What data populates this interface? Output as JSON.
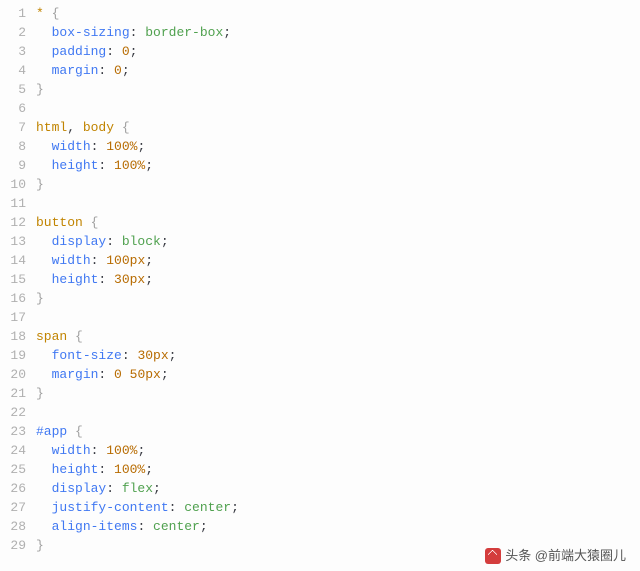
{
  "watermark": {
    "label": "头条 @前端大猿圈儿"
  },
  "lines": [
    {
      "n": 1,
      "tokens": [
        {
          "t": "*",
          "c": "sel"
        },
        {
          "t": " "
        },
        {
          "t": "{",
          "c": "punc"
        }
      ]
    },
    {
      "n": 2,
      "tokens": [
        {
          "t": "  "
        },
        {
          "t": "box-sizing",
          "c": "prop"
        },
        {
          "t": ": ",
          "c": "punc2"
        },
        {
          "t": "border-box",
          "c": "str"
        },
        {
          "t": ";",
          "c": "punc2"
        }
      ]
    },
    {
      "n": 3,
      "tokens": [
        {
          "t": "  "
        },
        {
          "t": "padding",
          "c": "prop"
        },
        {
          "t": ": ",
          "c": "punc2"
        },
        {
          "t": "0",
          "c": "num"
        },
        {
          "t": ";",
          "c": "punc2"
        }
      ]
    },
    {
      "n": 4,
      "tokens": [
        {
          "t": "  "
        },
        {
          "t": "margin",
          "c": "prop"
        },
        {
          "t": ": ",
          "c": "punc2"
        },
        {
          "t": "0",
          "c": "num"
        },
        {
          "t": ";",
          "c": "punc2"
        }
      ]
    },
    {
      "n": 5,
      "tokens": [
        {
          "t": "}",
          "c": "punc"
        }
      ]
    },
    {
      "n": 6,
      "tokens": []
    },
    {
      "n": 7,
      "tokens": [
        {
          "t": "html",
          "c": "sel"
        },
        {
          "t": ", ",
          "c": "punc2"
        },
        {
          "t": "body",
          "c": "sel"
        },
        {
          "t": " "
        },
        {
          "t": "{",
          "c": "punc"
        }
      ]
    },
    {
      "n": 8,
      "tokens": [
        {
          "t": "  "
        },
        {
          "t": "width",
          "c": "prop"
        },
        {
          "t": ": ",
          "c": "punc2"
        },
        {
          "t": "100%",
          "c": "num"
        },
        {
          "t": ";",
          "c": "punc2"
        }
      ]
    },
    {
      "n": 9,
      "tokens": [
        {
          "t": "  "
        },
        {
          "t": "height",
          "c": "prop"
        },
        {
          "t": ": ",
          "c": "punc2"
        },
        {
          "t": "100%",
          "c": "num"
        },
        {
          "t": ";",
          "c": "punc2"
        }
      ]
    },
    {
      "n": 10,
      "tokens": [
        {
          "t": "}",
          "c": "punc"
        }
      ]
    },
    {
      "n": 11,
      "tokens": []
    },
    {
      "n": 12,
      "tokens": [
        {
          "t": "button",
          "c": "sel"
        },
        {
          "t": " "
        },
        {
          "t": "{",
          "c": "punc"
        }
      ]
    },
    {
      "n": 13,
      "tokens": [
        {
          "t": "  "
        },
        {
          "t": "display",
          "c": "prop"
        },
        {
          "t": ": ",
          "c": "punc2"
        },
        {
          "t": "block",
          "c": "str"
        },
        {
          "t": ";",
          "c": "punc2"
        }
      ]
    },
    {
      "n": 14,
      "tokens": [
        {
          "t": "  "
        },
        {
          "t": "width",
          "c": "prop"
        },
        {
          "t": ": ",
          "c": "punc2"
        },
        {
          "t": "100px",
          "c": "num"
        },
        {
          "t": ";",
          "c": "punc2"
        }
      ]
    },
    {
      "n": 15,
      "tokens": [
        {
          "t": "  "
        },
        {
          "t": "height",
          "c": "prop"
        },
        {
          "t": ": ",
          "c": "punc2"
        },
        {
          "t": "30px",
          "c": "num"
        },
        {
          "t": ";",
          "c": "punc2"
        }
      ]
    },
    {
      "n": 16,
      "tokens": [
        {
          "t": "}",
          "c": "punc"
        }
      ]
    },
    {
      "n": 17,
      "tokens": []
    },
    {
      "n": 18,
      "tokens": [
        {
          "t": "span",
          "c": "sel"
        },
        {
          "t": " "
        },
        {
          "t": "{",
          "c": "punc"
        }
      ]
    },
    {
      "n": 19,
      "tokens": [
        {
          "t": "  "
        },
        {
          "t": "font-size",
          "c": "prop"
        },
        {
          "t": ": ",
          "c": "punc2"
        },
        {
          "t": "30px",
          "c": "num"
        },
        {
          "t": ";",
          "c": "punc2"
        }
      ]
    },
    {
      "n": 20,
      "tokens": [
        {
          "t": "  "
        },
        {
          "t": "margin",
          "c": "prop"
        },
        {
          "t": ": ",
          "c": "punc2"
        },
        {
          "t": "0",
          "c": "num"
        },
        {
          "t": " "
        },
        {
          "t": "50px",
          "c": "num"
        },
        {
          "t": ";",
          "c": "punc2"
        }
      ]
    },
    {
      "n": 21,
      "tokens": [
        {
          "t": "}",
          "c": "punc"
        }
      ]
    },
    {
      "n": 22,
      "tokens": []
    },
    {
      "n": 23,
      "tokens": [
        {
          "t": "#app",
          "c": "idsel"
        },
        {
          "t": " "
        },
        {
          "t": "{",
          "c": "punc"
        }
      ]
    },
    {
      "n": 24,
      "tokens": [
        {
          "t": "  "
        },
        {
          "t": "width",
          "c": "prop"
        },
        {
          "t": ": ",
          "c": "punc2"
        },
        {
          "t": "100%",
          "c": "num"
        },
        {
          "t": ";",
          "c": "punc2"
        }
      ]
    },
    {
      "n": 25,
      "tokens": [
        {
          "t": "  "
        },
        {
          "t": "height",
          "c": "prop"
        },
        {
          "t": ": ",
          "c": "punc2"
        },
        {
          "t": "100%",
          "c": "num"
        },
        {
          "t": ";",
          "c": "punc2"
        }
      ]
    },
    {
      "n": 26,
      "tokens": [
        {
          "t": "  "
        },
        {
          "t": "display",
          "c": "prop"
        },
        {
          "t": ": ",
          "c": "punc2"
        },
        {
          "t": "flex",
          "c": "str"
        },
        {
          "t": ";",
          "c": "punc2"
        }
      ]
    },
    {
      "n": 27,
      "tokens": [
        {
          "t": "  "
        },
        {
          "t": "justify-content",
          "c": "prop"
        },
        {
          "t": ": ",
          "c": "punc2"
        },
        {
          "t": "center",
          "c": "str"
        },
        {
          "t": ";",
          "c": "punc2"
        }
      ]
    },
    {
      "n": 28,
      "tokens": [
        {
          "t": "  "
        },
        {
          "t": "align-items",
          "c": "prop"
        },
        {
          "t": ": ",
          "c": "punc2"
        },
        {
          "t": "center",
          "c": "str"
        },
        {
          "t": ";",
          "c": "punc2"
        }
      ]
    },
    {
      "n": 29,
      "tokens": [
        {
          "t": "}",
          "c": "punc"
        }
      ]
    }
  ]
}
